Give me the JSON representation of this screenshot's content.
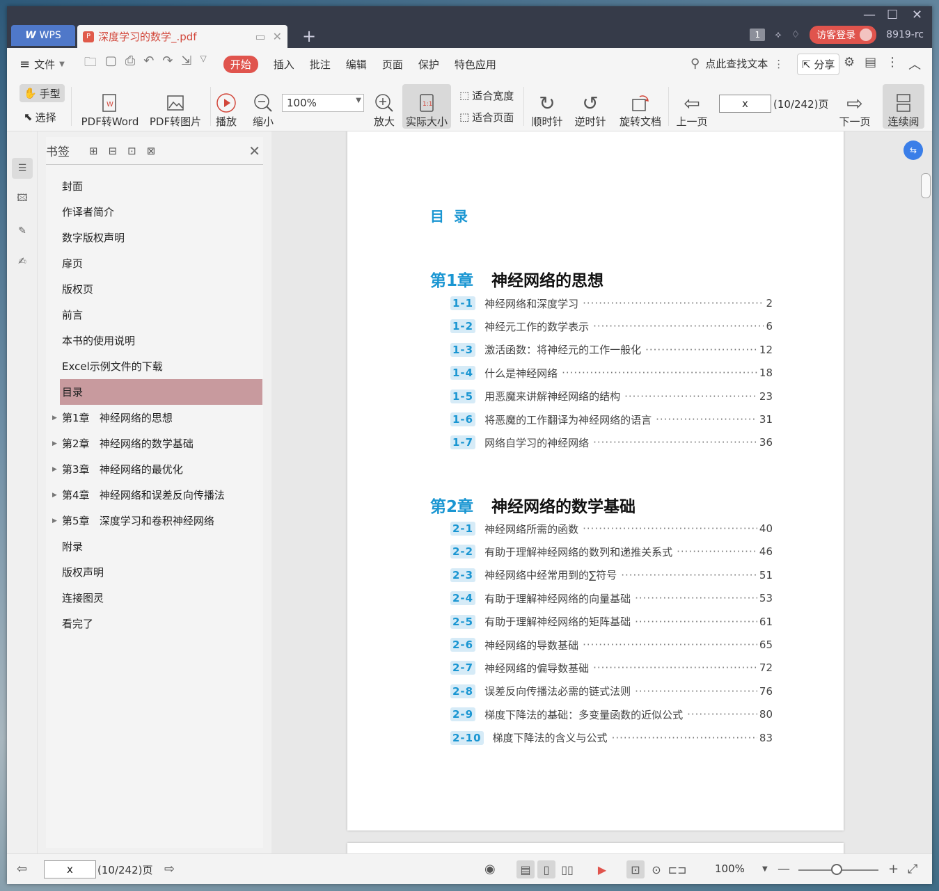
{
  "titlebar": {
    "wps_tab": "WPS",
    "doc_tab": "深度学习的数学_.pdf",
    "page_count_badge": "1",
    "login_button": "访客登录",
    "user_label": "8919-rc"
  },
  "menubar": {
    "file": "文件",
    "tabs": [
      "开始",
      "插入",
      "批注",
      "编辑",
      "页面",
      "保护",
      "特色应用"
    ],
    "active_tab": "开始",
    "search": "点此查找文本",
    "share": "分享"
  },
  "toolbar": {
    "hand": "手型",
    "select": "选择",
    "pdf_to_word": "PDF转Word",
    "pdf_to_image": "PDF转图片",
    "play": "播放",
    "zoom_out": "缩小",
    "zoom_value": "100%",
    "zoom_in": "放大",
    "actual_size": "实际大小",
    "fit_width": "适合宽度",
    "fit_page": "适合页面",
    "rotate_cw": "顺时针",
    "rotate_ccw": "逆时针",
    "rotate_doc": "旋转文档",
    "prev_page": "上一页",
    "page_input": "x",
    "page_info": "(10/242)页",
    "next_page": "下一页",
    "continuous": "连续阅"
  },
  "bookmarks": {
    "title": "书签",
    "items": [
      {
        "label": "封面",
        "expandable": false
      },
      {
        "label": "作译者简介",
        "expandable": false
      },
      {
        "label": "数字版权声明",
        "expandable": false
      },
      {
        "label": "扉页",
        "expandable": false
      },
      {
        "label": "版权页",
        "expandable": false
      },
      {
        "label": "前言",
        "expandable": false
      },
      {
        "label": "本书的使用说明",
        "expandable": false
      },
      {
        "label": "Excel示例文件的下载",
        "expandable": false
      },
      {
        "label": "目录",
        "expandable": false,
        "selected": true
      },
      {
        "label": "第1章   神经网络的思想",
        "expandable": true
      },
      {
        "label": "第2章   神经网络的数学基础",
        "expandable": true
      },
      {
        "label": "第3章   神经网络的最优化",
        "expandable": true
      },
      {
        "label": "第4章   神经网络和误差反向传播法",
        "expandable": true
      },
      {
        "label": "第5章   深度学习和卷积神经网络",
        "expandable": true
      },
      {
        "label": "附录",
        "expandable": false
      },
      {
        "label": "版权声明",
        "expandable": false
      },
      {
        "label": "连接图灵",
        "expandable": false
      },
      {
        "label": "看完了",
        "expandable": false
      }
    ]
  },
  "document": {
    "toc_title": "目录",
    "chapters": [
      {
        "number": "第1章",
        "title": "神经网络的思想",
        "sections": [
          {
            "num": "1-1",
            "title": "神经网络和深度学习",
            "page": "2"
          },
          {
            "num": "1-2",
            "title": "神经元工作的数学表示",
            "page": "6"
          },
          {
            "num": "1-3",
            "title": "激活函数：将神经元的工作一般化",
            "page": "12"
          },
          {
            "num": "1-4",
            "title": "什么是神经网络",
            "page": "18"
          },
          {
            "num": "1-5",
            "title": "用恶魔来讲解神经网络的结构",
            "page": "23"
          },
          {
            "num": "1-6",
            "title": "将恶魔的工作翻译为神经网络的语言",
            "page": "31"
          },
          {
            "num": "1-7",
            "title": "网络自学习的神经网络",
            "page": "36"
          }
        ]
      },
      {
        "number": "第2章",
        "title": "神经网络的数学基础",
        "sections": [
          {
            "num": "2-1",
            "title": "神经网络所需的函数",
            "page": "40"
          },
          {
            "num": "2-2",
            "title": "有助于理解神经网络的数列和递推关系式",
            "page": "46"
          },
          {
            "num": "2-3",
            "title": "神经网络中经常用到的∑符号",
            "page": "51"
          },
          {
            "num": "2-4",
            "title": "有助于理解神经网络的向量基础",
            "page": "53"
          },
          {
            "num": "2-5",
            "title": "有助于理解神经网络的矩阵基础",
            "page": "61"
          },
          {
            "num": "2-6",
            "title": "神经网络的导数基础",
            "page": "65"
          },
          {
            "num": "2-7",
            "title": "神经网络的偏导数基础",
            "page": "72"
          },
          {
            "num": "2-8",
            "title": "误差反向传播法必需的链式法则",
            "page": "76"
          },
          {
            "num": "2-9",
            "title": "梯度下降法的基础：多变量函数的近似公式",
            "page": "80"
          },
          {
            "num": "2-10",
            "title": "梯度下降法的含义与公式",
            "page": "83"
          }
        ]
      }
    ]
  },
  "statusbar": {
    "page_input": "x",
    "page_info": "(10/242)页",
    "zoom": "100%"
  },
  "colors": {
    "accent_red": "#e0544d",
    "toc_blue": "#1a96d2",
    "selected_bookmark": "#c89a9e",
    "titlebar": "#363b49"
  }
}
